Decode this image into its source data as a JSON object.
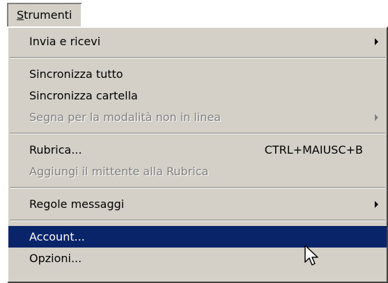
{
  "menubar": {
    "title_mnemonic": "S",
    "title_rest": "trumenti"
  },
  "menu": {
    "invia": {
      "label": "Invia e ricevi"
    },
    "sync_all": {
      "label": "Sincronizza tutto"
    },
    "sync_folder": {
      "label": "Sincronizza cartella"
    },
    "offline": {
      "label": "Segna per la modalità non in linea"
    },
    "rubrica": {
      "label": "Rubrica...",
      "shortcut": "CTRL+MAIUSC+B"
    },
    "add_sender": {
      "label": "Aggiungi il mittente alla Rubrica"
    },
    "rules": {
      "label": "Regole messaggi"
    },
    "account": {
      "label": "Account..."
    },
    "options": {
      "label": "Opzioni..."
    }
  },
  "colors": {
    "menu_bg": "#d4d0c8",
    "highlight": "#0a246a",
    "disabled_text": "#808080"
  },
  "icons": [
    "submenu-arrow-icon",
    "mouse-pointer-icon"
  ]
}
